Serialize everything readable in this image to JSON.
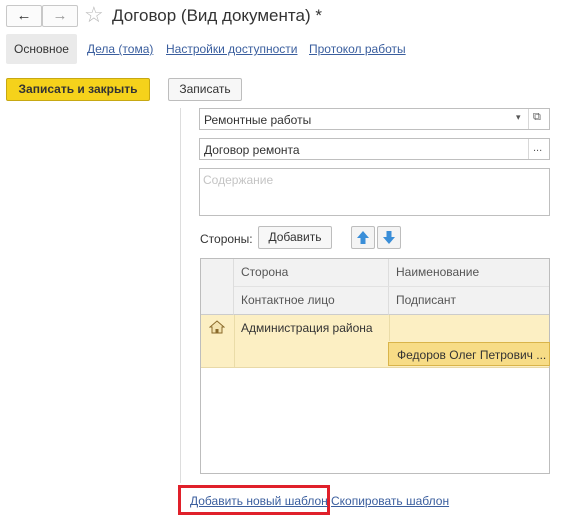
{
  "header": {
    "title": "Договор (Вид документа) *",
    "back_icon": "←",
    "forward_icon": "→",
    "star_icon": "☆"
  },
  "tabs": [
    {
      "label": "Основное"
    },
    {
      "label": "Дела (тома)"
    },
    {
      "label": "Настройки доступности"
    },
    {
      "label": "Протокол работы"
    }
  ],
  "toolbar": {
    "save_close_label": "Записать и закрыть",
    "save_label": "Записать"
  },
  "form": {
    "type_value": "Ремонтные работы",
    "template_value": "Договор ремонта",
    "content_placeholder": "Содержание",
    "sides_label": "Стороны:",
    "add_label": "Добавить"
  },
  "table": {
    "headers": {
      "side": "Сторона",
      "name": "Наименование",
      "contact": "Контактное лицо",
      "signer": "Подписант"
    },
    "rows": [
      {
        "side": "Администрация района",
        "name": "",
        "contact": "",
        "signer": "Федоров Олег Петрович ..."
      }
    ]
  },
  "footer": {
    "add_template": "Добавить новый шаблон",
    "copy_template": "Скопировать шаблон"
  },
  "colors": {
    "accent_yellow": "#f5d21b",
    "link_blue": "#3a5e9e",
    "highlight_red": "#e0202a",
    "selected_row": "#fcefc3"
  }
}
